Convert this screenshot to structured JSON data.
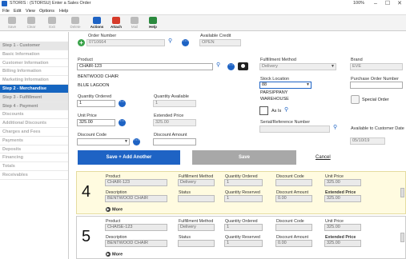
{
  "window": {
    "title": "STORIS : (STORSU) Enter a Sales Order",
    "zoom": "100%",
    "controls": [
      "–",
      "☐",
      "✕"
    ]
  },
  "menu": [
    "File",
    "Edit",
    "View",
    "Options",
    "Help"
  ],
  "toolbar": [
    {
      "label": "Save",
      "icon": "save-icon",
      "color": "#bbbbbb"
    },
    {
      "label": "Clear",
      "icon": "clear-icon",
      "color": "#bbbbbb"
    },
    {
      "label": "Exit",
      "icon": "exit-icon",
      "color": "#bbbbbb"
    },
    {
      "label": "Delete",
      "icon": "delete-icon",
      "color": "#bbbbbb"
    },
    {
      "label": "Actions",
      "icon": "actions-icon",
      "color": "#1e63c4"
    },
    {
      "label": "Attach",
      "icon": "paperclip-icon",
      "color": "#d63b2a"
    },
    {
      "label": "Mail",
      "icon": "mail-icon",
      "color": "#bbbbbb"
    },
    {
      "label": "Help",
      "icon": "help-icon",
      "color": "#2b8a3e"
    }
  ],
  "sidebar": [
    {
      "label": "Step 1 - Customer",
      "kind": "step"
    },
    {
      "label": "Basic Information",
      "kind": "sub"
    },
    {
      "label": "Customer Information",
      "kind": "sub"
    },
    {
      "label": "Billing Information",
      "kind": "sub"
    },
    {
      "label": "Marketing Information",
      "kind": "sub"
    },
    {
      "label": "Step 2 - Merchandise",
      "kind": "active"
    },
    {
      "label": "Step 3 - Fulfillment",
      "kind": "step"
    },
    {
      "label": "Step 4 - Payment",
      "kind": "step"
    },
    {
      "label": "Discounts",
      "kind": "sub"
    },
    {
      "label": "Additional Discounts",
      "kind": "sub"
    },
    {
      "label": "Charges and Fees",
      "kind": "sub"
    },
    {
      "label": "Payments",
      "kind": "sub"
    },
    {
      "label": "Deposits",
      "kind": "sub"
    },
    {
      "label": "Financing",
      "kind": "sub"
    },
    {
      "label": "Totals",
      "kind": "sub"
    },
    {
      "label": "Receivables",
      "kind": "sub"
    }
  ],
  "header": {
    "order_number_label": "Order Number",
    "order_number": "0710664",
    "available_credit_label": "Available Credit",
    "available_credit": "OPEN"
  },
  "form": {
    "product_label": "Product",
    "product": "CHAIR-123",
    "product_desc1": "BENTWOOD CHAIR",
    "product_desc2": "BLUE LAGOON",
    "fulfillment_method_label": "Fulfillment Method",
    "fulfillment_method": "Delivery",
    "brand_label": "Brand",
    "brand": "EVE",
    "purchase_order_label": "Purchase Order Number",
    "purchase_order": "",
    "stock_location_label": "Stock Location",
    "stock_location": "88",
    "stock_location_name1": "PARSIPPANY",
    "stock_location_name2": "WAREHOUSE",
    "as_is_label": "As Is",
    "special_order_label": "Special Order",
    "quantity_ordered_label": "Quantity Ordered",
    "quantity_ordered": "1",
    "quantity_available_label": "Quantity Available",
    "quantity_available": "1",
    "unit_price_label": "Unit Price",
    "unit_price": "325.00",
    "extended_price_label": "Extended Price",
    "extended_price": "325.00",
    "serial_label": "Serial/Reference Number",
    "serial": "",
    "available_to_customer_label": "Available to Customer Date",
    "available_to_customer": "05/10/19",
    "discount_code_label": "Discount Code",
    "discount_code": "",
    "discount_amount_label": "Discount Amount",
    "discount_amount": "",
    "save_add_label": "Save + Add Another",
    "save_label": "Save",
    "cancel_label": "Cancel"
  },
  "line_headers": {
    "product": "Product",
    "fulfillment": "Fulfillment Method",
    "qty_ordered": "Quantity Ordered",
    "discount_code": "Discount Code",
    "unit_price": "Unit Price",
    "description": "Description",
    "status": "Status",
    "qty_reserved": "Quantity Reserved",
    "discount_amount": "Discount Amount",
    "extended_price": "Extended Price",
    "more": "More"
  },
  "lines": [
    {
      "number": "4",
      "product": "CHAIR-123",
      "fulfillment": "Delivery",
      "qty_ordered": "1",
      "discount_code": "",
      "unit_price": "325.00",
      "description": "BENTWOOD CHAIR",
      "status": "",
      "qty_reserved": "1",
      "discount_amount": "0.00",
      "extended_price": "325.00"
    },
    {
      "number": "5",
      "product": "CHAISE-123",
      "fulfillment": "Delivery",
      "qty_ordered": "1",
      "discount_code": "",
      "unit_price": "325.00",
      "description": "BENTWOOD CHAIR",
      "status": "",
      "qty_reserved": "1",
      "discount_amount": "0.00",
      "extended_price": "325.00"
    }
  ]
}
